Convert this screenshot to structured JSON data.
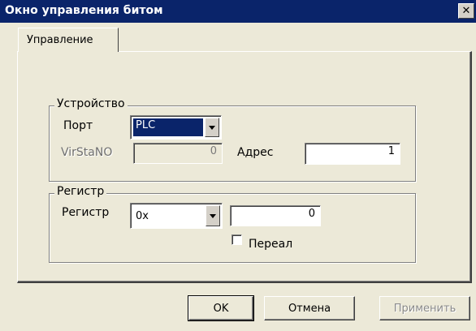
{
  "window": {
    "title": "Окно управления битом",
    "close_glyph": "✕"
  },
  "tabs": [
    {
      "label": "Управление",
      "active": true
    }
  ],
  "device_group": {
    "label": "Устройство",
    "port_label": "Порт",
    "port_value": "PLC",
    "virstano_label": "VirStaNO",
    "virstano_value": "0",
    "address_label": "Адрес",
    "address_value": "1"
  },
  "register_group": {
    "label": "Регистр",
    "register_label": "Регистр",
    "register_type": "0x",
    "register_value": "0",
    "realtime_label": "Переал",
    "realtime_checked": false
  },
  "buttons": {
    "ok": "OK",
    "cancel": "Отмена",
    "apply": "Применить"
  },
  "colors": {
    "titlebar": "#0a246a",
    "face": "#ece9d8",
    "selection": "#0a246a"
  }
}
